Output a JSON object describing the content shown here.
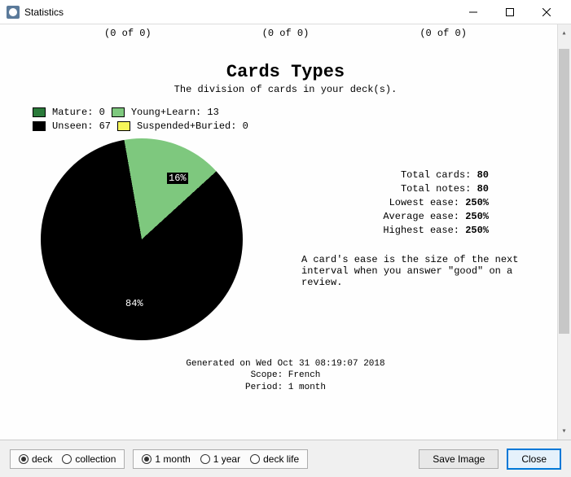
{
  "window": {
    "title": "Statistics",
    "top_counts": [
      "(0 of 0)",
      "(0 of 0)",
      "(0 of 0)"
    ]
  },
  "section": {
    "title": "Cards Types",
    "subtitle": "The division of cards in your deck(s)."
  },
  "legend": [
    {
      "color": "#2a7a3a",
      "label": "Mature: 0"
    },
    {
      "color": "#7ec87e",
      "label": "Young+Learn: 13"
    },
    {
      "color": "#000000",
      "label": "Unseen: 67"
    },
    {
      "color": "#f5f55a",
      "label": "Suspended+Buried: 0"
    }
  ],
  "chart_data": {
    "type": "pie",
    "title": "Cards Types",
    "series": [
      {
        "name": "Mature",
        "value": 0,
        "pct": 0,
        "color": "#2a7a3a"
      },
      {
        "name": "Young+Learn",
        "value": 13,
        "pct": 16,
        "color": "#7ec87e"
      },
      {
        "name": "Unseen",
        "value": 67,
        "pct": 84,
        "color": "#000000"
      },
      {
        "name": "Suspended+Buried",
        "value": 0,
        "pct": 0,
        "color": "#f5f55a"
      }
    ],
    "labels": {
      "slice1": "16%",
      "slice2": "84%"
    }
  },
  "stats": {
    "total_cards_label": "Total cards:",
    "total_cards": "80",
    "total_notes_label": "Total notes:",
    "total_notes": "80",
    "lowest_ease_label": "Lowest ease:",
    "lowest_ease": "250%",
    "average_ease_label": "Average ease:",
    "average_ease": "250%",
    "highest_ease_label": "Highest ease:",
    "highest_ease": "250%",
    "note": "A card's ease is the size of the next interval when you answer \"good\" on a review."
  },
  "footer": {
    "generated": "Generated on Wed Oct 31 08:19:07 2018",
    "scope": "Scope: French",
    "period": "Period: 1 month"
  },
  "controls": {
    "scope_group": [
      {
        "label": "deck",
        "checked": true
      },
      {
        "label": "collection",
        "checked": false
      }
    ],
    "period_group": [
      {
        "label": "1 month",
        "checked": true
      },
      {
        "label": "1 year",
        "checked": false
      },
      {
        "label": "deck life",
        "checked": false
      }
    ],
    "save_image": "Save Image",
    "close": "Close"
  }
}
